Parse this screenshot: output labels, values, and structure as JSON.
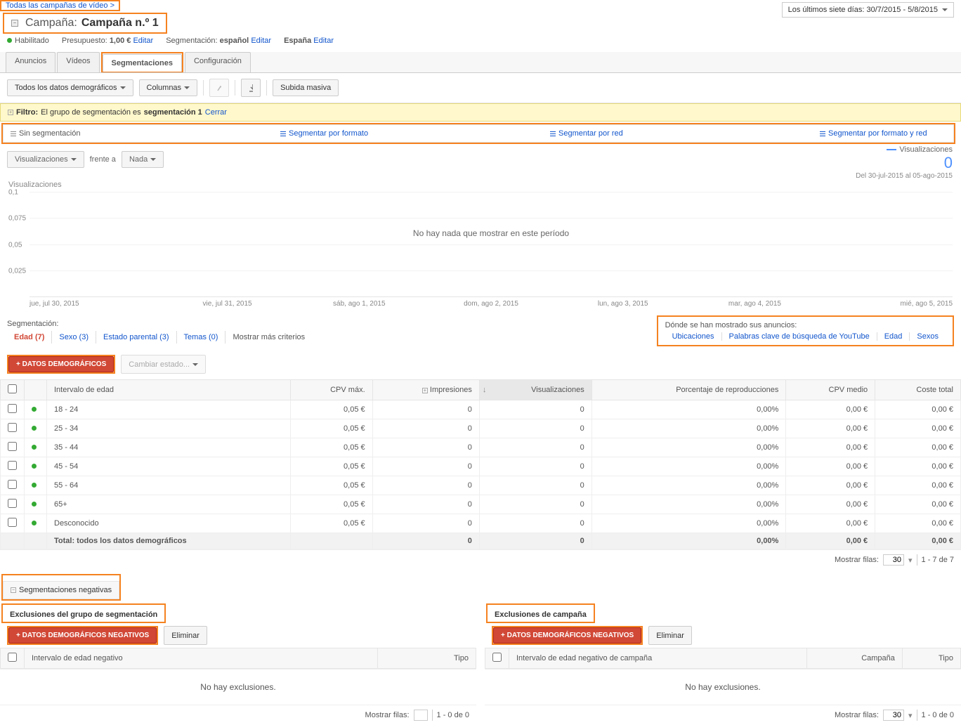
{
  "breadcrumb": "Todas las campañas de vídeo >",
  "title": {
    "prefix": "Campaña:",
    "name": "Campaña n.º 1"
  },
  "status": {
    "enabled": "Habilitado",
    "budget_label": "Presupuesto:",
    "budget_value": "1,00 €",
    "edit": "Editar",
    "segmentation_label": "Segmentación:",
    "segmentation_value": "español",
    "country": "España"
  },
  "date_range": "Los últimos siete días: 30/7/2015 - 5/8/2015",
  "tabs": [
    "Anuncios",
    "Vídeos",
    "Segmentaciones",
    "Configuración"
  ],
  "active_tab": 2,
  "toolbar": {
    "demo_filter": "Todos los datos demográficos",
    "columns": "Columnas",
    "upload": "Subida masiva"
  },
  "filter_bar": {
    "label": "Filtro:",
    "text_a": "El grupo de segmentación es ",
    "text_b": "segmentación 1",
    "close": "Cerrar"
  },
  "segment_options": [
    "Sin segmentación",
    "Segmentar por formato",
    "Segmentar por red",
    "Segmentar por formato y red"
  ],
  "chart_controls": {
    "metric": "Visualizaciones",
    "vs": "frente a",
    "none": "Nada"
  },
  "legend": {
    "label": "Visualizaciones",
    "value": "0",
    "range": "Del 30-jul-2015 al 05-ago-2015"
  },
  "chart_data": {
    "type": "line",
    "title": "Visualizaciones",
    "empty_message": "No hay nada que mostrar en este período",
    "y_ticks": [
      "0,1",
      "0,075",
      "0,05",
      "0,025"
    ],
    "x_labels": [
      "jue, jul 30, 2015",
      "vie, jul 31, 2015",
      "sáb, ago 1, 2015",
      "dom, ago 2, 2015",
      "lun, ago 3, 2015",
      "mar, ago 4, 2015",
      "mié, ago 5, 2015"
    ],
    "series": [
      {
        "name": "Visualizaciones",
        "values": [
          0,
          0,
          0,
          0,
          0,
          0,
          0
        ]
      }
    ],
    "ylim": [
      0,
      0.1
    ]
  },
  "criteria": {
    "label": "Segmentación:",
    "tabs": [
      {
        "label": "Edad (7)",
        "active": true
      },
      {
        "label": "Sexo (3)"
      },
      {
        "label": "Estado parental (3)"
      },
      {
        "label": "Temas (0)"
      },
      {
        "label": "Mostrar más criterios",
        "plain": true
      }
    ]
  },
  "side_box": {
    "title": "Dónde se han mostrado sus anuncios:",
    "links": [
      "Ubicaciones",
      "Palabras clave de búsqueda de YouTube",
      "Edad",
      "Sexos"
    ]
  },
  "actions": {
    "add": "+ DATOS DEMOGRÁFICOS",
    "change_state": "Cambiar estado..."
  },
  "table": {
    "headers": [
      "Intervalo de edad",
      "CPV máx.",
      "Impresiones",
      "Visualizaciones",
      "Porcentaje de reproducciones",
      "CPV medio",
      "Coste total"
    ],
    "rows": [
      {
        "label": "18 - 24",
        "cpv": "0,05 €",
        "imp": "0",
        "views": "0",
        "pct": "0,00%",
        "avg": "0,00 €",
        "cost": "0,00 €"
      },
      {
        "label": "25 - 34",
        "cpv": "0,05 €",
        "imp": "0",
        "views": "0",
        "pct": "0,00%",
        "avg": "0,00 €",
        "cost": "0,00 €"
      },
      {
        "label": "35 - 44",
        "cpv": "0,05 €",
        "imp": "0",
        "views": "0",
        "pct": "0,00%",
        "avg": "0,00 €",
        "cost": "0,00 €"
      },
      {
        "label": "45 - 54",
        "cpv": "0,05 €",
        "imp": "0",
        "views": "0",
        "pct": "0,00%",
        "avg": "0,00 €",
        "cost": "0,00 €"
      },
      {
        "label": "55 - 64",
        "cpv": "0,05 €",
        "imp": "0",
        "views": "0",
        "pct": "0,00%",
        "avg": "0,00 €",
        "cost": "0,00 €"
      },
      {
        "label": "65+",
        "cpv": "0,05 €",
        "imp": "0",
        "views": "0",
        "pct": "0,00%",
        "avg": "0,00 €",
        "cost": "0,00 €"
      },
      {
        "label": "Desconocido",
        "cpv": "0,05 €",
        "imp": "0",
        "views": "0",
        "pct": "0,00%",
        "avg": "0,00 €",
        "cost": "0,00 €"
      }
    ],
    "total": {
      "label": "Total: todos los datos demográficos",
      "imp": "0",
      "views": "0",
      "pct": "0,00%",
      "avg": "0,00 €",
      "cost": "0,00 €"
    }
  },
  "pager": {
    "show_rows": "Mostrar filas:",
    "size": "30",
    "range": "1 - 7 de 7"
  },
  "neg_section": "Segmentaciones negativas",
  "exclusions": {
    "group": {
      "title": "Exclusiones del grupo de segmentación",
      "add": "+ DATOS DEMOGRÁFICOS NEGATIVOS",
      "remove": "Eliminar",
      "col1": "Intervalo de edad negativo",
      "col2": "Tipo",
      "empty": "No hay exclusiones.",
      "pager": "Mostrar filas:",
      "size": "",
      "range": "1 - 0 de 0"
    },
    "campaign": {
      "title": "Exclusiones de campaña",
      "add": "+ DATOS DEMOGRÁFICOS NEGATIVOS",
      "remove": "Eliminar",
      "col1": "Intervalo de edad negativo de campaña",
      "col2": "Campaña",
      "col3": "Tipo",
      "empty": "No hay exclusiones.",
      "pager": "Mostrar filas:",
      "size": "30",
      "range": "1 - 0 de 0"
    }
  }
}
